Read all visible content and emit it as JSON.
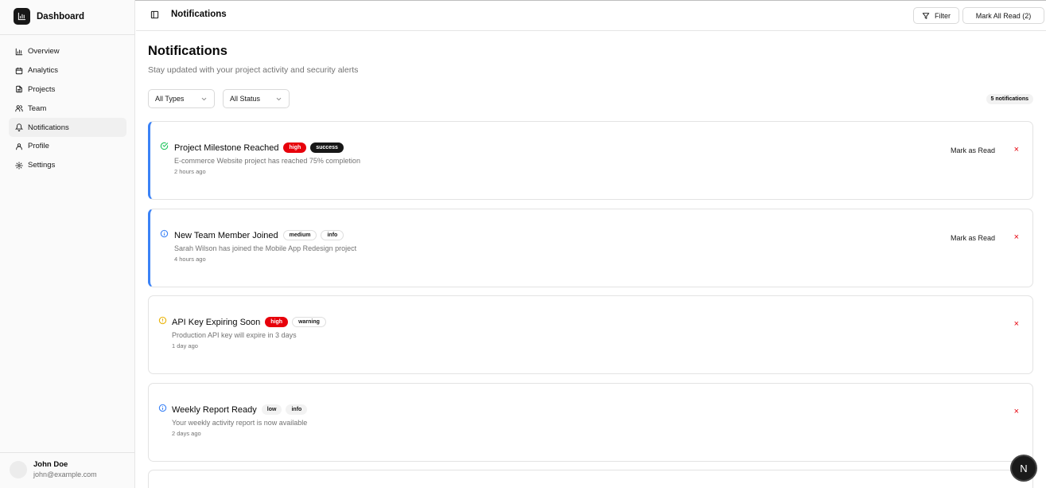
{
  "brand": {
    "name": "Dashboard"
  },
  "sidebar": {
    "items": [
      {
        "label": "Overview",
        "icon": "bar-chart-icon"
      },
      {
        "label": "Analytics",
        "icon": "calendar-icon"
      },
      {
        "label": "Projects",
        "icon": "file-icon"
      },
      {
        "label": "Team",
        "icon": "users-icon"
      },
      {
        "label": "Notifications",
        "icon": "bell-icon",
        "active": true
      },
      {
        "label": "Profile",
        "icon": "user-icon"
      },
      {
        "label": "Settings",
        "icon": "gear-icon"
      }
    ]
  },
  "user": {
    "name": "John Doe",
    "email": "john@example.com"
  },
  "topbar": {
    "title": "Notifications",
    "filter_label": "Filter",
    "mark_all_label": "Mark All Read (2)"
  },
  "page": {
    "title": "Notifications",
    "subtitle": "Stay updated with your project activity and security alerts",
    "type_select": "All Types",
    "status_select": "All Status",
    "count_label": "5 notifications"
  },
  "notifications": [
    {
      "title": "Project Milestone Reached",
      "priority": "high",
      "type": "success",
      "message": "E-commerce Website project has reached 75% completion",
      "time": "2 hours ago",
      "unread": true,
      "mark_read_label": "Mark as Read",
      "icon": "check-circle-icon"
    },
    {
      "title": "New Team Member Joined",
      "priority": "medium",
      "type": "info",
      "message": "Sarah Wilson has joined the Mobile App Redesign project",
      "time": "4 hours ago",
      "unread": true,
      "mark_read_label": "Mark as Read",
      "icon": "info-icon"
    },
    {
      "title": "API Key Expiring Soon",
      "priority": "high",
      "type": "warning",
      "message": "Production API key will expire in 3 days",
      "time": "1 day ago",
      "unread": false,
      "icon": "alert-circle-icon"
    },
    {
      "title": "Weekly Report Ready",
      "priority": "low",
      "type": "info",
      "message": "Your weekly activity report is now available",
      "time": "2 days ago",
      "unread": false,
      "icon": "info-icon"
    }
  ],
  "dismiss_glyph": "×",
  "fab_label": "N",
  "colors": {
    "accent": "#3b82f6",
    "danger": "#e7000b",
    "success": "#22c55e",
    "warning": "#eab308"
  }
}
